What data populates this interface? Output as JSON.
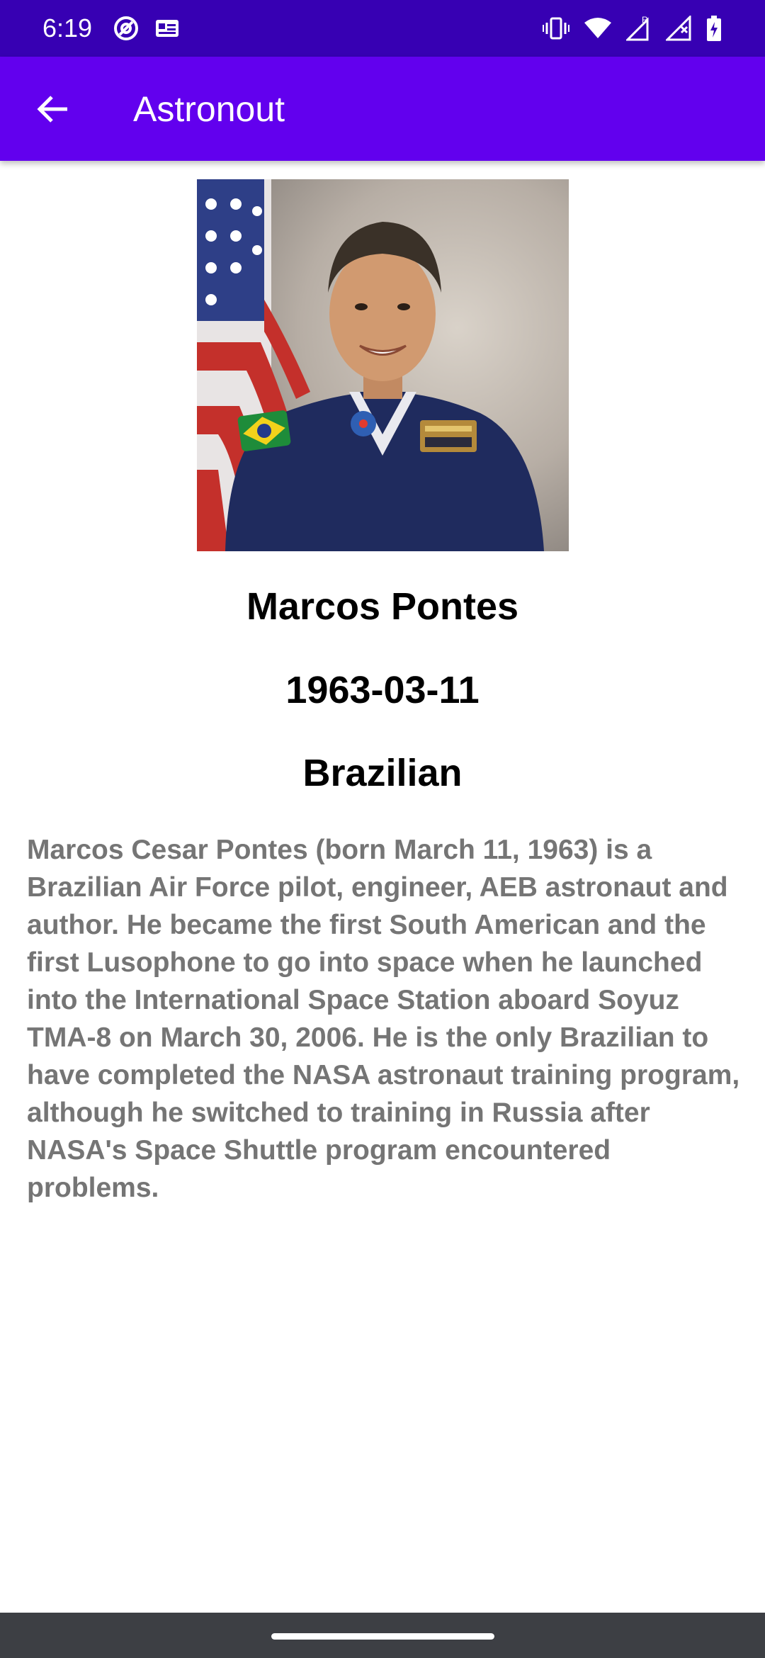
{
  "status_bar": {
    "time": "6:19",
    "left_icons": [
      "at-sign-icon",
      "id-card-icon"
    ],
    "right_icons": [
      "vibrate-icon",
      "wifi-icon",
      "signal-r-icon",
      "signal-icon",
      "battery-charging-icon"
    ]
  },
  "app_bar": {
    "title": "Astronout",
    "back_icon": "arrow-left-icon",
    "background": "#6200ee"
  },
  "astronaut": {
    "photo_alt": "Portrait of astronaut in blue flight suit in front of a US flag",
    "name": "Marcos Pontes",
    "birth_date": "1963-03-11",
    "nationality": "Brazilian",
    "bio": "Marcos Cesar Pontes (born March 11, 1963) is a Brazilian Air Force pilot, engineer, AEB astronaut and author. He became the first South American and the first Lusophone to go into space when he launched into the International Space Station aboard Soyuz TMA-8 on March 30, 2006. He is the only Brazilian to have completed the NASA astronaut training program, although he switched to training in Russia after NASA's Space Shuttle program encountered problems."
  },
  "colors": {
    "status_bar": "#3700b3",
    "app_bar": "#6200ee",
    "bio_text": "#757575",
    "nav_bar": "#3d3f44"
  }
}
